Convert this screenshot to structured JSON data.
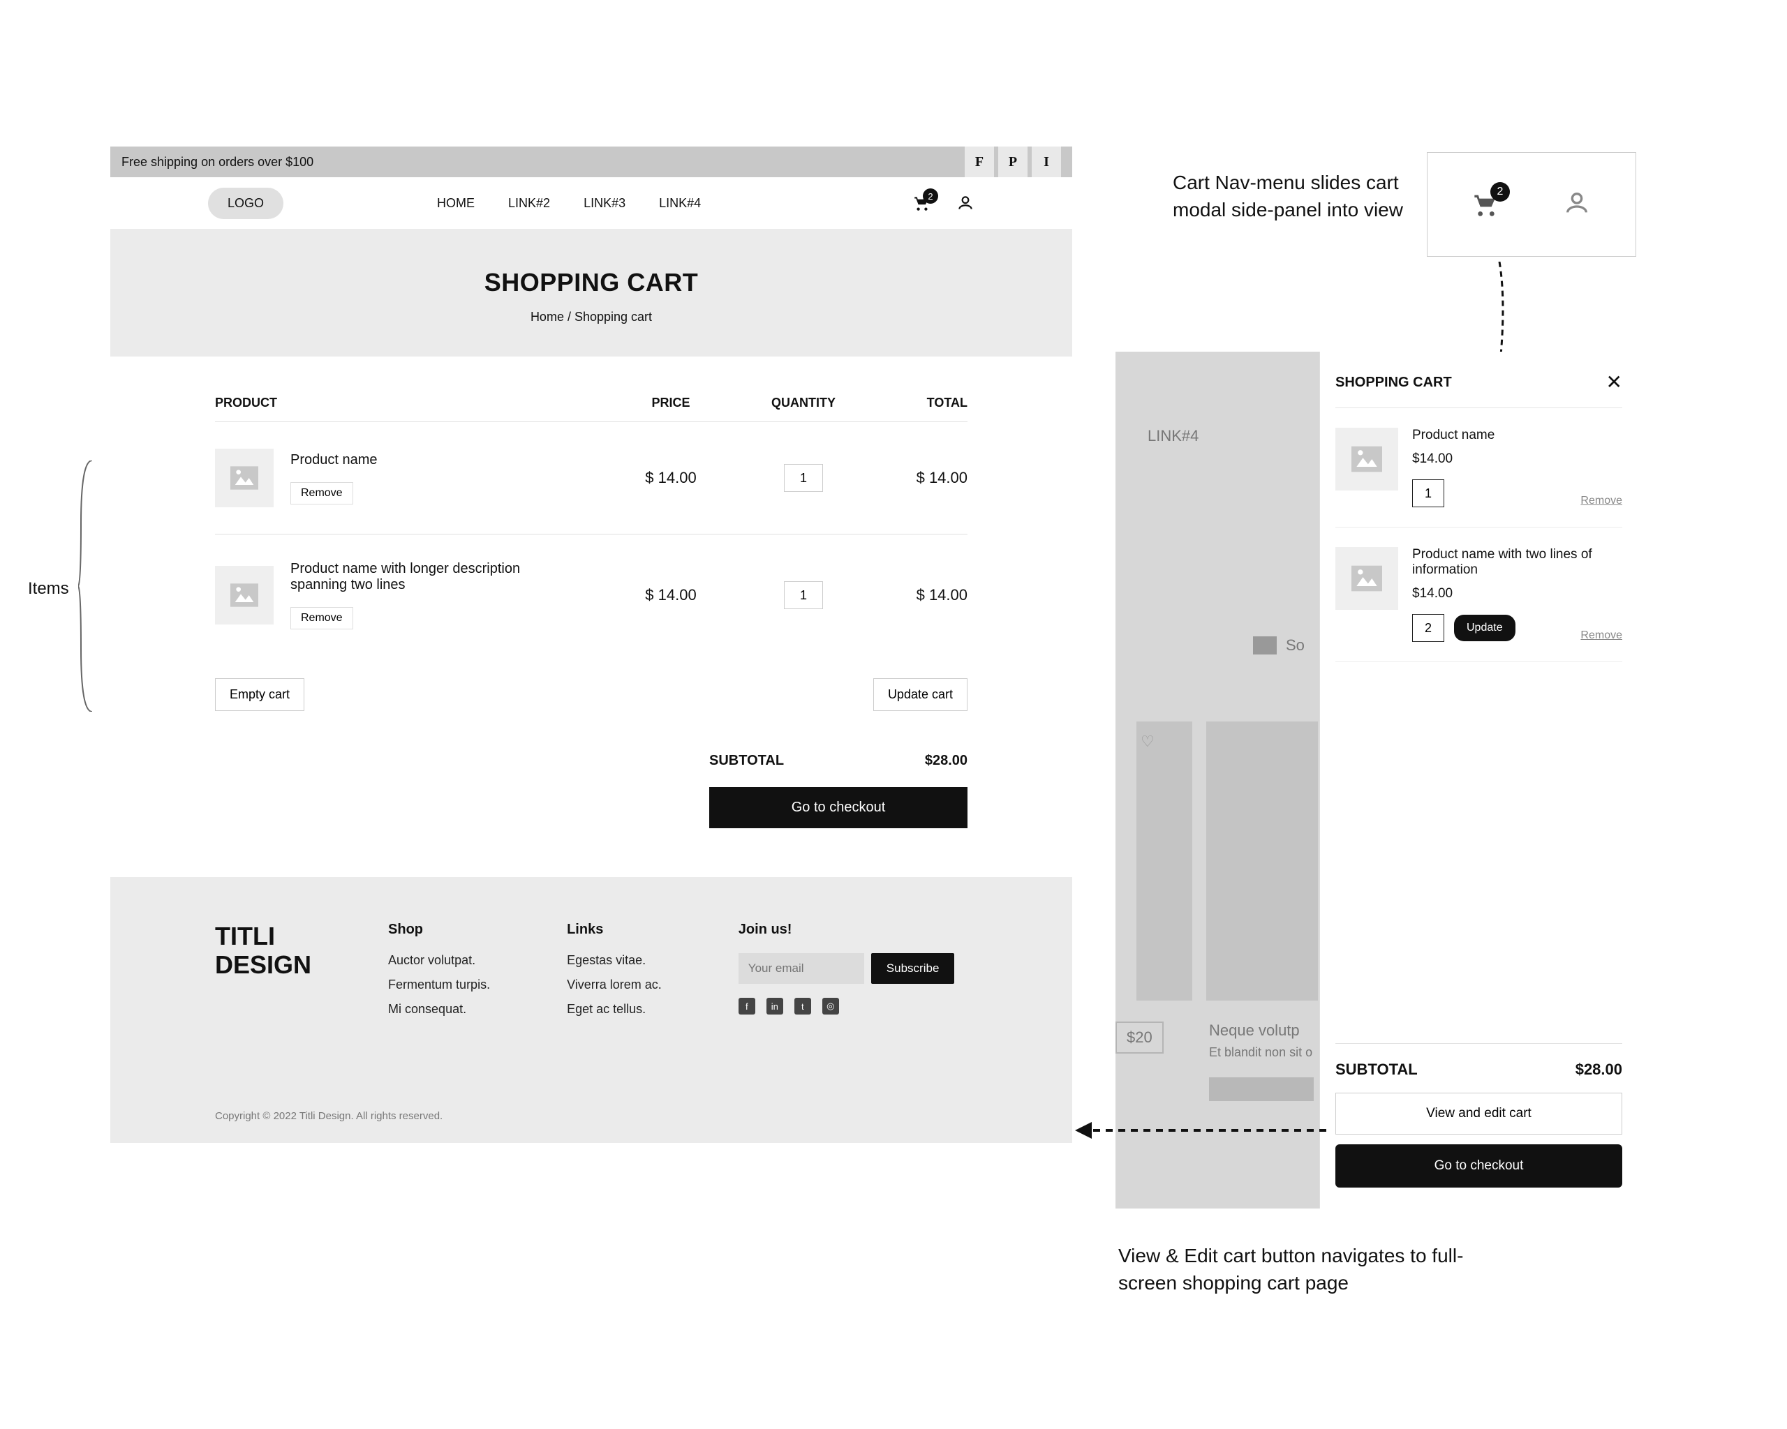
{
  "announce": {
    "text": "Free shipping on orders over $100",
    "icons": [
      "F",
      "P",
      "I"
    ]
  },
  "nav": {
    "logo": "LOGO",
    "links": [
      "HOME",
      "LINK#2",
      "LINK#3",
      "LINK#4"
    ],
    "cart_badge": "2"
  },
  "title": {
    "heading": "SHOPPING CART",
    "crumb_home": "Home",
    "crumb_sep": " / ",
    "crumb_current": "Shopping cart"
  },
  "table": {
    "head": {
      "product": "PRODUCT",
      "price": "PRICE",
      "qty": "QUANTITY",
      "total": "TOTAL"
    },
    "rows": [
      {
        "name": "Product name",
        "price": "$ 14.00",
        "qty": "1",
        "total": "$ 14.00",
        "remove": "Remove"
      },
      {
        "name": "Product name with longer description spanning two lines",
        "price": "$ 14.00",
        "qty": "1",
        "total": "$ 14.00",
        "remove": "Remove"
      }
    ],
    "empty": "Empty cart",
    "update": "Update cart"
  },
  "subtotal": {
    "label": "SUBTOTAL",
    "value": "$28.00",
    "checkout": "Go to checkout"
  },
  "footer": {
    "brand_l1": "TITLI",
    "brand_l2": "DESIGN",
    "col1": {
      "title": "Shop",
      "items": [
        "Auctor volutpat.",
        "Fermentum turpis.",
        "Mi consequat."
      ]
    },
    "col2": {
      "title": "Links",
      "items": [
        "Egestas vitae.",
        "Viverra lorem ac.",
        "Eget ac tellus."
      ]
    },
    "col3": {
      "title": "Join us!",
      "placeholder": "Your email",
      "btn": "Subscribe"
    },
    "copy": "Copyright © 2022 Titli Design. All rights reserved."
  },
  "annot": {
    "items": "Items",
    "slide": "Cart Nav-menu slides cart modal side-panel into view",
    "back": "View & Edit cart button navigates to full-screen shopping cart page"
  },
  "snippet": {
    "badge": "2"
  },
  "panel": {
    "title": "SHOPPING CART",
    "items": [
      {
        "name": "Product name",
        "price": "$14.00",
        "qty": "1",
        "remove": "Remove",
        "show_update": false
      },
      {
        "name": "Product name with two lines of information",
        "price": "$14.00",
        "qty": "2",
        "remove": "Remove",
        "show_update": true,
        "update": "Update"
      }
    ],
    "subtotal_label": "SUBTOTAL",
    "subtotal_value": "$28.00",
    "view": "View and edit cart",
    "checkout": "Go to checkout"
  },
  "bgpage": {
    "link": "LINK#4",
    "sort": "So",
    "price": "$20",
    "prod_name": "Neque volutp",
    "prod_sub": "Et blandit non sit o"
  }
}
